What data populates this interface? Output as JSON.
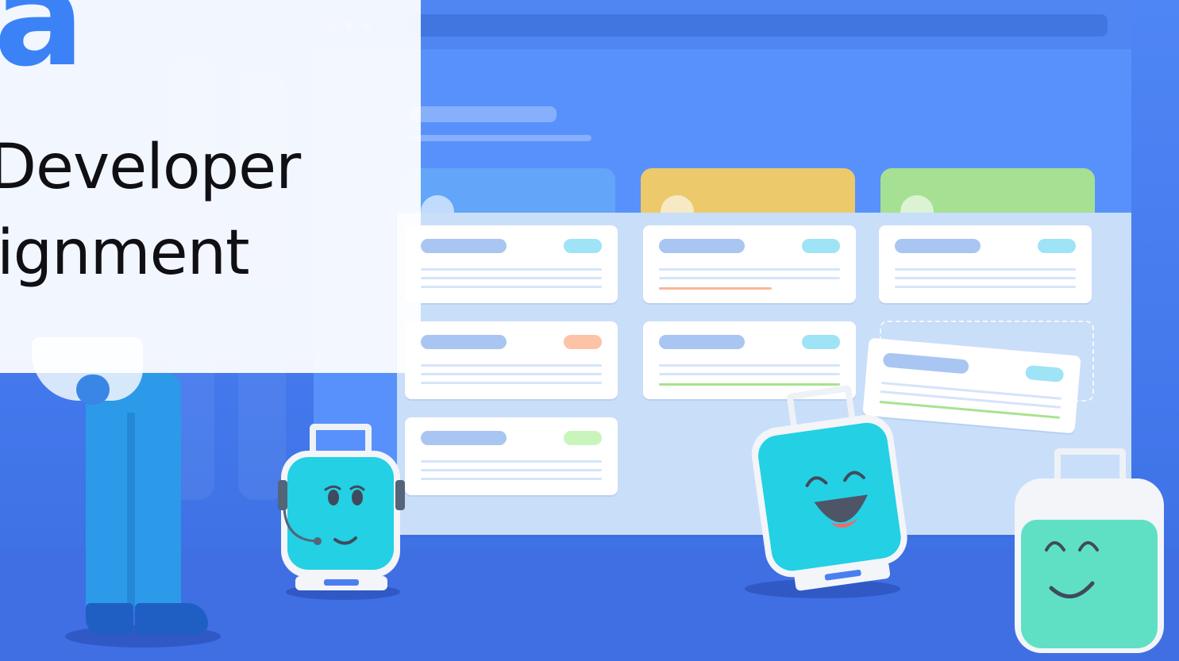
{
  "brand": {
    "logo_text": "a",
    "color": "#3b82f6"
  },
  "title": {
    "line1": "Developer",
    "line2": "ignment"
  },
  "board": {
    "columns": [
      {
        "name": "column-blue",
        "color": "#63a5f8"
      },
      {
        "name": "column-yellow",
        "color": "#ecc96a"
      },
      {
        "name": "column-green",
        "color": "#a6e092"
      }
    ],
    "tag_colors": {
      "cyan": "#9fe3f6",
      "orange": "#fdc3a6",
      "green": "#c9f5bd",
      "accent_orange_line": "#f7b795",
      "accent_green_line": "#a8e38f"
    }
  },
  "colors": {
    "background": "#4a7ff0",
    "window": "#5891fb",
    "board": "#c9def9",
    "robot_face_cyan": "#24d0e3",
    "robot_face_mint": "#5fe0c4"
  },
  "icons": {
    "robot_support": "headset-robot-icon",
    "robot_happy": "laughing-robot-icon",
    "robot_calm": "smiling-robot-icon",
    "person": "person-illustration"
  }
}
